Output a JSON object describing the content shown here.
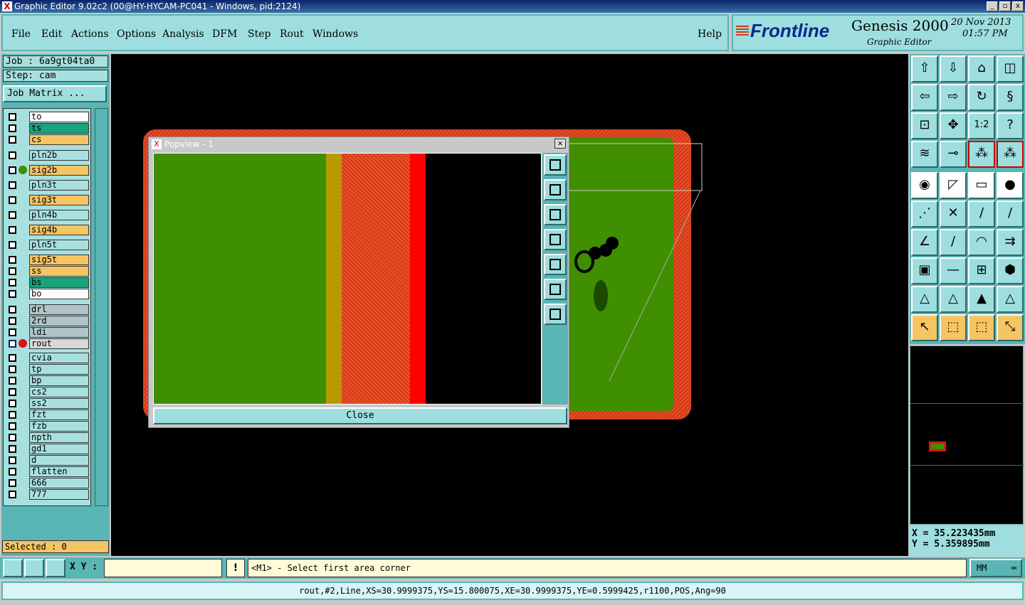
{
  "window": {
    "title": "Graphic Editor 9.02c2 (00@HY-HYCAM-PC041 - Windows, pid:2124)"
  },
  "menu": [
    "File",
    "Edit",
    "Actions",
    "Options",
    "Analysis",
    "DFM",
    "Step",
    "Rout",
    "Windows"
  ],
  "help": "Help",
  "brand": {
    "logo": "Frontline",
    "product": "Genesis 2000",
    "subtitle": "Graphic Editor",
    "date": "20 Nov 2013",
    "time": "01:57 PM"
  },
  "job": {
    "job_label": "Job : 6a9gt04ta0",
    "step_label": "Step: cam",
    "matrix_button": "Job Matrix ..."
  },
  "layers": [
    {
      "name": "to",
      "color": "#ffffff"
    },
    {
      "name": "ts",
      "color": "#1aa37a"
    },
    {
      "name": "cs",
      "color": "#f5c463"
    },
    {
      "name": "pln2b",
      "color": "#a8e0e0"
    },
    {
      "name": "sig2b",
      "color": "#f5c463"
    },
    {
      "name": "pln3t",
      "color": "#a8e0e0"
    },
    {
      "name": "sig3t",
      "color": "#f5c463"
    },
    {
      "name": "pln4b",
      "color": "#a8e0e0"
    },
    {
      "name": "sig4b",
      "color": "#f5c463"
    },
    {
      "name": "pln5t",
      "color": "#a8e0e0"
    },
    {
      "name": "sig5t",
      "color": "#f5c463"
    },
    {
      "name": "ss",
      "color": "#f5c463"
    },
    {
      "name": "bs",
      "color": "#1aa37a"
    },
    {
      "name": "bo",
      "color": "#ffffff"
    },
    {
      "name": "drl",
      "color": "#b0c4c8"
    },
    {
      "name": "2rd",
      "color": "#b0c4c8"
    },
    {
      "name": "ldi",
      "color": "#b0c4c8"
    },
    {
      "name": "rout",
      "color": "#d8d8d8"
    },
    {
      "name": "cvia",
      "color": "#a8e0e0"
    },
    {
      "name": "tp",
      "color": "#a8e0e0"
    },
    {
      "name": "bp",
      "color": "#a8e0e0"
    },
    {
      "name": "cs2",
      "color": "#a8e0e0"
    },
    {
      "name": "ss2",
      "color": "#a8e0e0"
    },
    {
      "name": "fzt",
      "color": "#a8e0e0"
    },
    {
      "name": "fzb",
      "color": "#a8e0e0"
    },
    {
      "name": "npth",
      "color": "#a8e0e0"
    },
    {
      "name": "gd1",
      "color": "#a8e0e0"
    },
    {
      "name": "d",
      "color": "#a8e0e0"
    },
    {
      "name": "flatten",
      "color": "#a8e0e0"
    },
    {
      "name": "666",
      "color": "#a8e0e0"
    },
    {
      "name": "777",
      "color": "#a8e0e0"
    }
  ],
  "selected": "Selected : 0",
  "popup": {
    "title": "Popview - 1",
    "close": "Close"
  },
  "coords": {
    "x": "X = 35.223435mm",
    "y": "Y = 5.359895mm"
  },
  "bottom": {
    "xy_label": "X Y :",
    "xy_value": "",
    "exclaim": "!",
    "prompt": "<M1> - Select first area corner",
    "units": "MM"
  },
  "status": "rout,#2,Line,XS=30.9999375,YS=15.800075,XE=30.9999375,YE=0.5999425,r1100,POS,Ang=90"
}
